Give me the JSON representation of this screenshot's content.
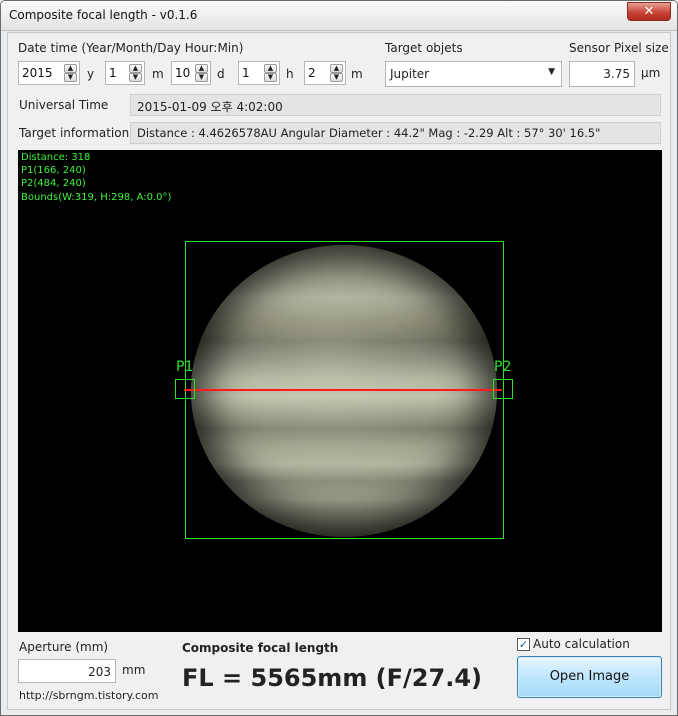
{
  "window": {
    "title": "Composite focal length - v0.1.6",
    "close_glyph": "✕"
  },
  "datetime": {
    "label": "Date time (Year/Month/Day Hour:Min)",
    "year": "2015",
    "year_unit": "y",
    "month": "1",
    "month_unit": "m",
    "day": "10",
    "day_unit": "d",
    "hour": "1",
    "hour_unit": "h",
    "minute": "2",
    "minute_unit": "m"
  },
  "target": {
    "label": "Target objets",
    "selected": "Jupiter"
  },
  "sensor": {
    "label": "Sensor Pixel size",
    "value": "3.75",
    "unit": "μm"
  },
  "universal_time": {
    "label": "Universal Time",
    "value": "2015-01-09 오후 4:02:00"
  },
  "target_info": {
    "label": "Target information",
    "value": "Distance : 4.4626578AU   Angular Diameter : 44.2\"   Mag : -2.29   Alt : 57° 30' 16.5\""
  },
  "overlay": {
    "distance": "Distance: 318",
    "p1": "P1(166, 240)",
    "p2": "P2(484, 240)",
    "bounds": "Bounds(W:319, H:298, A:0.0°)",
    "p1_label": "P1",
    "p2_label": "P2"
  },
  "aperture": {
    "label": "Aperture (mm)",
    "value": "203",
    "unit": "mm"
  },
  "result": {
    "label": "Composite focal length",
    "value": "FL = 5565mm (F/27.4)"
  },
  "auto_calc": {
    "label": "Auto calculation",
    "checked": true,
    "check_glyph": "✓"
  },
  "open_image_button": "Open Image",
  "footer_link": "http://sbrngm.tistory.com",
  "colors": {
    "overlay_green": "#2fe02f",
    "measure_red": "#ff1a1a"
  }
}
